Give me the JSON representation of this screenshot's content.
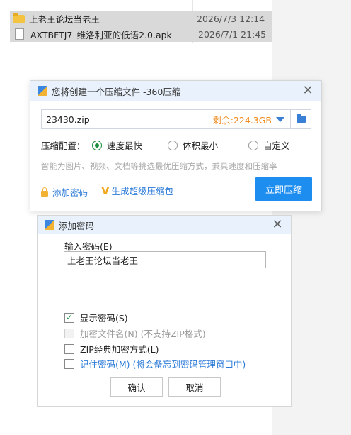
{
  "explorer": {
    "files": [
      {
        "name": "上老王论坛当老王",
        "date": "2026/7/3 12:14",
        "type": "folder"
      },
      {
        "name": "AXTBFTJ7_维洛利亚的低语2.0.apk",
        "date": "2026/7/1 21:45",
        "type": "file"
      }
    ]
  },
  "compress_dialog": {
    "title": "您将创建一个压缩文件 -360压缩",
    "filename": "23430.zip",
    "remaining_space": "剩余:224.3GB",
    "config_label": "压缩配置：",
    "options": [
      "速度最快",
      "体积最小",
      "自定义"
    ],
    "selected_option": "速度最快",
    "hint": "智能为图片、视频、文档等挑选最优压缩方式，兼具速度和压缩率",
    "add_password_link": "添加密码",
    "super_pack_link": "生成超级压缩包",
    "compress_button": "立即压缩"
  },
  "password_dialog": {
    "title": "添加密码",
    "input_label": "输入密码(E)",
    "password_value": "上老王论坛当老王",
    "show_password": "显示密码(S)",
    "encrypt_filenames": "加密文件名(N) (不支持ZIP格式)",
    "zip_classic": "ZIP经典加密方式(L)",
    "remember_password": "记住密码(M) (将会备忘到密码管理窗口中)",
    "ok_button": "确认",
    "cancel_button": "取消"
  },
  "colors": {
    "accent_blue": "#1d8ef0",
    "title_bar": "#e9f2fc",
    "space_orange": "#f08a1c",
    "radio_green": "#1a8f3a"
  }
}
